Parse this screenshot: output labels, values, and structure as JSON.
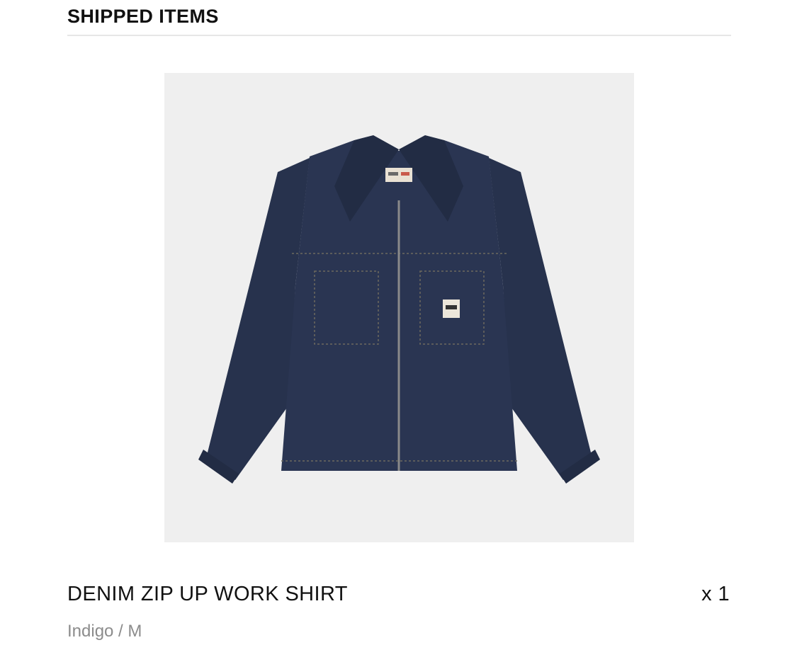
{
  "section": {
    "title": "SHIPPED ITEMS"
  },
  "item": {
    "image_icon": "denim-jacket-image",
    "name": "DENIM ZIP UP WORK SHIRT",
    "quantity": "x 1",
    "variant": "Indigo / M"
  },
  "colors": {
    "text": "#111111",
    "muted": "#8c8c8c",
    "divider": "#e6e6e6",
    "image_bg": "#efefef",
    "denim": "#27324d"
  }
}
